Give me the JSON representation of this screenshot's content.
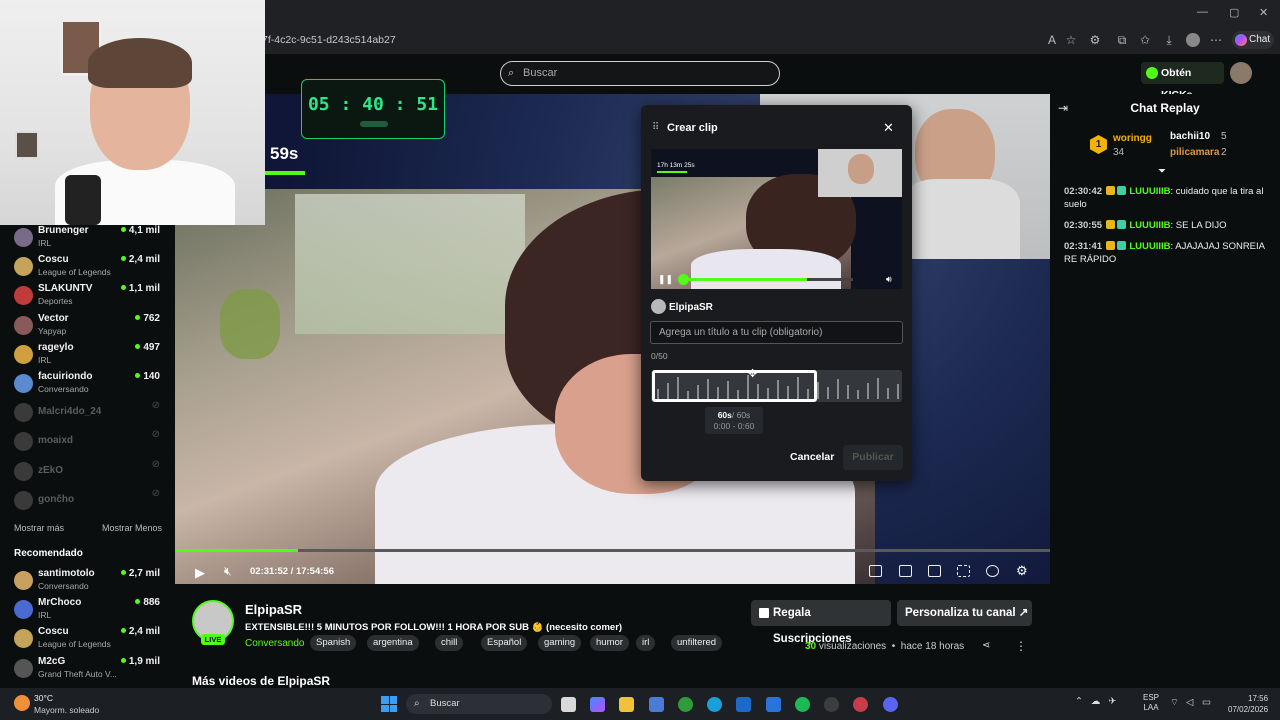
{
  "browser": {
    "url": "7f-4c2c-9c51-d243c514ab27",
    "chat_button": "Chat"
  },
  "header": {
    "search_placeholder": "Buscar",
    "kicks_button": "Obtén KICKs"
  },
  "overlay": {
    "timer_h": "05",
    "timer_m": "40",
    "timer_s": "51",
    "seconds_label": "59s"
  },
  "sidebar": {
    "following": [
      {
        "name": "Brunenger",
        "category": "IRL",
        "viewers": "4,1 mil",
        "online": true
      },
      {
        "name": "Coscu",
        "category": "League of Legends",
        "viewers": "2,4 mil",
        "online": true
      },
      {
        "name": "SLAKUNTV",
        "category": "Deportes",
        "viewers": "1,1 mil",
        "online": true
      },
      {
        "name": "Vector",
        "category": "Yapyap",
        "viewers": "762",
        "online": true
      },
      {
        "name": "rageylo",
        "category": "IRL",
        "viewers": "497",
        "online": true
      },
      {
        "name": "facuiriondo",
        "category": "Conversando",
        "viewers": "140",
        "online": true
      },
      {
        "name": "Malcri4do_24",
        "online": false
      },
      {
        "name": "moaixd",
        "online": false
      },
      {
        "name": "zEkO",
        "online": false
      },
      {
        "name": "gončho",
        "online": false
      }
    ],
    "show_more": "Mostrar más",
    "show_less": "Mostrar Menos",
    "recommended_title": "Recomendado",
    "recommended": [
      {
        "name": "santimotolo",
        "category": "Conversando",
        "viewers": "2,7 mil"
      },
      {
        "name": "MrChoco",
        "category": "IRL",
        "viewers": "886"
      },
      {
        "name": "Coscu",
        "category": "League of Legends",
        "viewers": "2,4 mil"
      },
      {
        "name": "M2cG",
        "category": "Grand Theft Auto V...",
        "viewers": "1,9 mil"
      }
    ]
  },
  "player": {
    "time_current": "02:31:52",
    "time_sep": "/",
    "time_total": "17:54:56",
    "progress_fraction": 0.14
  },
  "clip_modal": {
    "title": "Crear clip",
    "preview_overlay_text": "17h 13m 25s",
    "author": "ElpipaSR",
    "title_placeholder": "Agrega un título a tu clip (obligatorio)",
    "char_count": "0/50",
    "duration_selected": "60s",
    "duration_max": "/ 60s",
    "range": "0:00 - 0:60",
    "cancel_label": "Cancelar",
    "publish_label": "Publicar"
  },
  "stream_info": {
    "channel_name": "ElpipaSR",
    "live_badge": "LIVE",
    "stream_title": "EXTENSIBLE!!! 5 MINUTOS POR FOLLOW!!! 1 HORA POR SUB 👶 (necesito comer)",
    "category": "Conversando",
    "tags": [
      "Spanish",
      "argentina",
      "chill",
      "Español",
      "gaming",
      "humor",
      "irl",
      "unfiltered"
    ],
    "gift_button": "Regala Suscripciones",
    "customize_button": "Personaliza tu canal",
    "views_count": "30",
    "views_label": "visualizaciones",
    "time_ago": "hace 18 horas",
    "more_videos": "Más videos de ElpipaSR"
  },
  "chat": {
    "title": "Chat Replay",
    "leaderboard": [
      {
        "rank": "1",
        "name": "woringg",
        "count": "34"
      },
      {
        "name": "bachii10",
        "count": "5"
      },
      {
        "name": "pilicamara",
        "count": "2"
      }
    ],
    "messages": [
      {
        "time": "02:30:42",
        "user": "LUUUIIIB",
        "text": "cuidado que la tira al suelo"
      },
      {
        "time": "02:30:55",
        "user": "LUUUIIIB",
        "text": "SE LA DIJO"
      },
      {
        "time": "02:31:41",
        "user": "LUUUIIIB",
        "text": "AJAJAJAJ SONREIA RE RÁPIDO"
      }
    ]
  },
  "taskbar": {
    "temperature": "30°C",
    "weather": "Mayorm. soleado",
    "search": "Buscar",
    "lang1": "ESP",
    "lang2": "LAA",
    "time": "17:56",
    "date": "07/02/2026"
  },
  "colors": {
    "kick_green": "#53fc18",
    "bg": "#0b0e0f",
    "modal_bg": "#191b1f"
  }
}
